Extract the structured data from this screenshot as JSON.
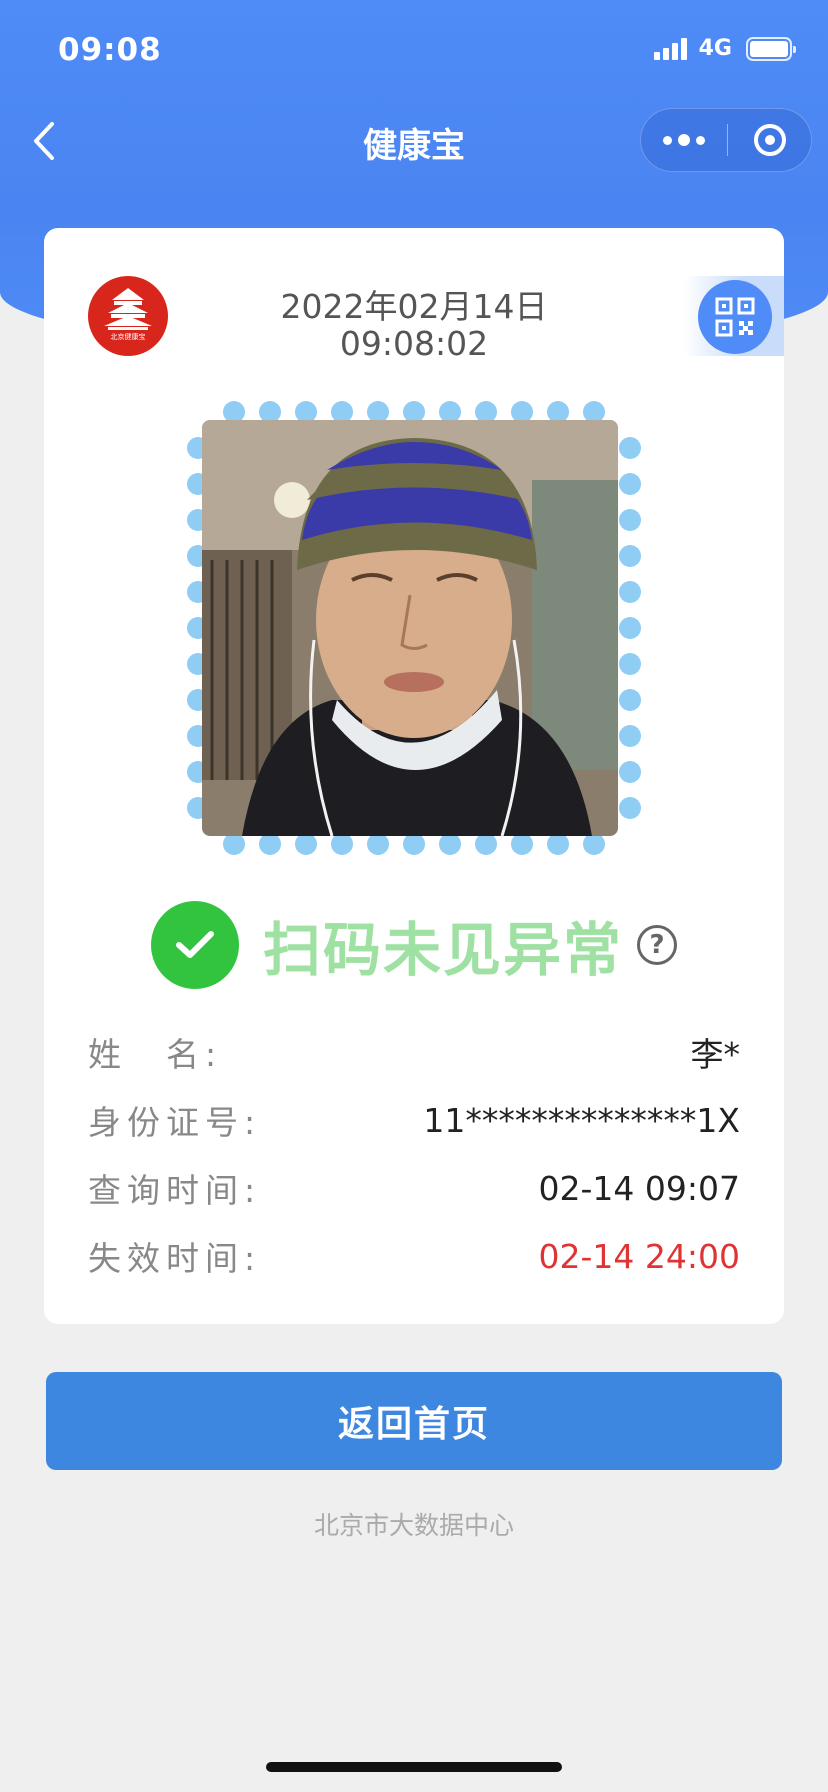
{
  "status_bar": {
    "time": "09:08",
    "network": "4G"
  },
  "nav": {
    "title": "健康宝"
  },
  "card": {
    "logo_caption": "北京健康宝",
    "date": "2022年02月14日",
    "time": "09:08:02",
    "status_text": "扫码未见异常",
    "help_glyph": "?",
    "info": [
      {
        "label": "姓　名:",
        "value": "李*",
        "highlight": false
      },
      {
        "label": "身份证号:",
        "value": "11**************1X",
        "highlight": false
      },
      {
        "label": "查询时间:",
        "value": "02-14 09:07",
        "highlight": false
      },
      {
        "label": "失效时间:",
        "value": "02-14 24:00",
        "highlight": true
      }
    ]
  },
  "actions": {
    "home_button": "返回首页"
  },
  "footer": "北京市大数据中心",
  "colors": {
    "header_blue": "#4f8cf7",
    "button_blue": "#3e87e0",
    "status_green": "#33c43f",
    "status_text_green": "#9fe0a3",
    "expire_red": "#e03434",
    "frame_dot": "#8fcdf5"
  },
  "icons": [
    "back-icon",
    "more-icon",
    "target-icon",
    "qr-code-icon",
    "check-icon",
    "help-icon"
  ]
}
